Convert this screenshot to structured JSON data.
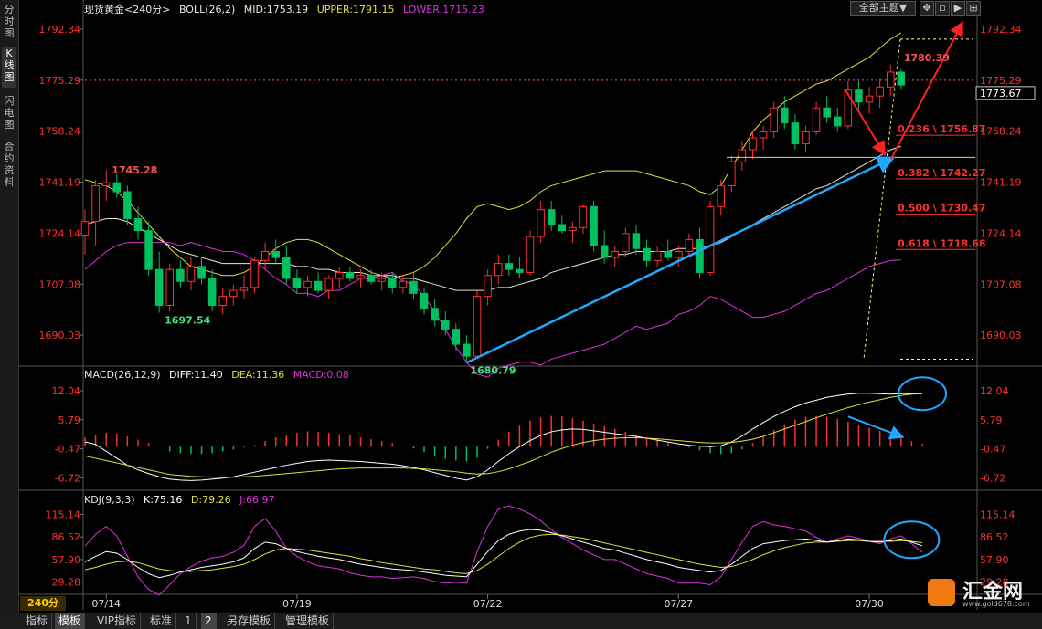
{
  "left_tabs": [
    "分时图",
    "K线图",
    "闪电图",
    "合约资料"
  ],
  "top_buttons": {
    "theme": "全部主题▼",
    "btn1": "✥",
    "btn2": "▫",
    "btn3": "▶",
    "btn4": "⊞"
  },
  "price_panel": {
    "symbol": "现货黄金<240分>",
    "boll_label": "BOLL(26,2)",
    "mid_label": "MID:1753.19",
    "upper_label": "UPPER:1791.15",
    "lower_label": "LOWER:1715.23",
    "y_ticks": [
      1792.34,
      1775.29,
      1758.24,
      1741.19,
      1724.14,
      1707.08,
      1690.03
    ],
    "current_price": "1773.67",
    "annotations": {
      "high": "1780.39",
      "left_high": "1745.28",
      "left_low": "1697.54",
      "low": "1680.79"
    },
    "fib_levels": [
      {
        "label": "0.236 \\ 1756.87",
        "value": 1756.87
      },
      {
        "label": "0.382 \\ 1742.27",
        "value": 1742.27
      },
      {
        "label": "0.500 \\ 1730.47",
        "value": 1730.47
      },
      {
        "label": "0.618 \\ 1718.68",
        "value": 1718.68
      }
    ]
  },
  "macd_panel": {
    "label": "MACD(26,12,9)",
    "diff_label": "DIFF:11.40",
    "dea_label": "DEA:11.36",
    "macd_label": "MACD:0.08",
    "y_ticks": [
      12.04,
      5.79,
      -0.47,
      -6.72
    ]
  },
  "kdj_panel": {
    "label": "KDJ(9,3,3)",
    "k_label": "K:75.16",
    "d_label": "D:79.26",
    "j_label": "J:66.97",
    "y_ticks": [
      115.14,
      86.52,
      57.9,
      29.28
    ]
  },
  "x_dates": [
    "07/14",
    "07/19",
    "07/22",
    "07/27",
    "07/30"
  ],
  "period": "240分",
  "bottom_tabs": [
    "指标",
    "模板",
    "VIP指标",
    "标准",
    "1",
    "2",
    "另存模板",
    "管理模板"
  ],
  "watermark": {
    "name": "汇金网",
    "url": "www.gold678.com"
  },
  "colors": {
    "up": "#ff3030",
    "down": "#00c060",
    "mid": "#e8e8d0",
    "upper": "#e0e040",
    "lower": "#e030e0",
    "dif": "#ffffff",
    "dea": "#e0e040",
    "k": "#ffffff",
    "d": "#e0e040",
    "j": "#e030e0",
    "trend": "#1ea8ff",
    "arrow_red": "#ff2020",
    "axis": "#ff3030"
  },
  "chart_data": {
    "type": "candlestick",
    "xlim": [
      0,
      84
    ],
    "price_ylim": [
      1680.0,
      1796.0
    ],
    "date_index": [
      [
        2,
        "07/14"
      ],
      [
        20,
        "07/19"
      ],
      [
        38,
        "07/22"
      ],
      [
        56,
        "07/27"
      ],
      [
        74,
        "07/30"
      ]
    ],
    "candles": [
      [
        1723.5,
        1732,
        1717,
        1728
      ],
      [
        1728,
        1742,
        1720,
        1740
      ],
      [
        1740,
        1745.28,
        1735,
        1741
      ],
      [
        1741,
        1744,
        1736,
        1738
      ],
      [
        1738,
        1740,
        1727,
        1729
      ],
      [
        1729,
        1733,
        1722,
        1725
      ],
      [
        1725,
        1728,
        1710,
        1712
      ],
      [
        1712,
        1718,
        1697.54,
        1700
      ],
      [
        1700,
        1714,
        1698,
        1712
      ],
      [
        1712,
        1715,
        1706,
        1708
      ],
      [
        1708,
        1716,
        1705,
        1713
      ],
      [
        1713,
        1716,
        1707,
        1709
      ],
      [
        1709,
        1712,
        1698,
        1700
      ],
      [
        1700,
        1706,
        1697,
        1703
      ],
      [
        1703,
        1707,
        1700,
        1705
      ],
      [
        1705,
        1710,
        1702,
        1706
      ],
      [
        1706,
        1716,
        1704,
        1715
      ],
      [
        1715,
        1721,
        1712,
        1718
      ],
      [
        1718,
        1722,
        1714,
        1716
      ],
      [
        1716,
        1720,
        1707,
        1709
      ],
      [
        1709,
        1712,
        1704,
        1706
      ],
      [
        1706,
        1710,
        1703,
        1708
      ],
      [
        1708,
        1711,
        1704,
        1705
      ],
      [
        1705,
        1710,
        1702,
        1709
      ],
      [
        1709,
        1713,
        1706,
        1711
      ],
      [
        1711,
        1713,
        1708,
        1709
      ],
      [
        1709,
        1712,
        1706,
        1710
      ],
      [
        1710,
        1712,
        1707,
        1708
      ],
      [
        1708,
        1711,
        1705,
        1709
      ],
      [
        1709,
        1711,
        1704,
        1706
      ],
      [
        1706,
        1710,
        1704,
        1708
      ],
      [
        1708,
        1711,
        1702,
        1704
      ],
      [
        1704,
        1706,
        1697,
        1699
      ],
      [
        1699,
        1702,
        1693,
        1695
      ],
      [
        1695,
        1698,
        1690,
        1692
      ],
      [
        1692,
        1694,
        1685,
        1687
      ],
      [
        1687,
        1690,
        1680.79,
        1683
      ],
      [
        1683,
        1705,
        1682,
        1703
      ],
      [
        1703,
        1712,
        1700,
        1710
      ],
      [
        1710,
        1717,
        1707,
        1714
      ],
      [
        1714,
        1717,
        1710,
        1712
      ],
      [
        1712,
        1716,
        1709,
        1711
      ],
      [
        1711,
        1725,
        1710,
        1723
      ],
      [
        1723,
        1735,
        1721,
        1732
      ],
      [
        1732,
        1735,
        1725,
        1727
      ],
      [
        1727,
        1730,
        1724,
        1725
      ],
      [
        1725,
        1728,
        1721,
        1726
      ],
      [
        1726,
        1734,
        1724,
        1733
      ],
      [
        1733,
        1735,
        1718,
        1720
      ],
      [
        1720,
        1725,
        1714,
        1716
      ],
      [
        1716,
        1720,
        1713,
        1718
      ],
      [
        1718,
        1726,
        1716,
        1724
      ],
      [
        1724,
        1727,
        1717,
        1719
      ],
      [
        1719,
        1722,
        1713,
        1715
      ],
      [
        1715,
        1720,
        1713,
        1718
      ],
      [
        1718,
        1722,
        1715,
        1716
      ],
      [
        1716,
        1720,
        1713,
        1718
      ],
      [
        1718,
        1724,
        1716,
        1722
      ],
      [
        1722,
        1726,
        1709,
        1711
      ],
      [
        1711,
        1735,
        1710,
        1733
      ],
      [
        1733,
        1742,
        1730,
        1740
      ],
      [
        1740,
        1750,
        1738,
        1748
      ],
      [
        1748,
        1755,
        1745,
        1752
      ],
      [
        1752,
        1758,
        1749,
        1756
      ],
      [
        1756,
        1760,
        1752,
        1758
      ],
      [
        1758,
        1768,
        1756,
        1766
      ],
      [
        1766,
        1770,
        1759,
        1761
      ],
      [
        1761,
        1764,
        1752,
        1754
      ],
      [
        1754,
        1760,
        1751,
        1758
      ],
      [
        1758,
        1768,
        1757,
        1766
      ],
      [
        1766,
        1770,
        1761,
        1763
      ],
      [
        1763,
        1766,
        1758,
        1760
      ],
      [
        1760,
        1775,
        1759,
        1772
      ],
      [
        1772,
        1775,
        1765,
        1768
      ],
      [
        1768,
        1773,
        1764,
        1770
      ],
      [
        1770,
        1776,
        1766,
        1773
      ],
      [
        1773,
        1780.39,
        1770,
        1778
      ],
      [
        1778,
        1779,
        1772,
        1773.67
      ]
    ],
    "boll_upper": [
      1742,
      1741,
      1740,
      1738,
      1735,
      1731,
      1727,
      1723,
      1719,
      1716,
      1713,
      1712,
      1711,
      1710,
      1710,
      1711,
      1713,
      1716,
      1719,
      1721,
      1722,
      1722,
      1721,
      1719,
      1717,
      1715,
      1713,
      1711,
      1710,
      1709,
      1710,
      1711,
      1713,
      1716,
      1720,
      1724,
      1729,
      1733,
      1734,
      1733,
      1732,
      1733,
      1735,
      1738,
      1740,
      1741,
      1742,
      1743,
      1744,
      1745,
      1745,
      1745,
      1745,
      1744,
      1743,
      1742,
      1741,
      1740,
      1738,
      1737,
      1740,
      1746,
      1752,
      1758,
      1762,
      1765,
      1768,
      1770,
      1772,
      1774,
      1775,
      1777,
      1779,
      1781,
      1783,
      1786,
      1789,
      1791.15
    ],
    "boll_mid": [
      1727,
      1728,
      1729,
      1729,
      1728,
      1726,
      1724,
      1722,
      1720,
      1718,
      1717,
      1716,
      1715,
      1714,
      1714,
      1714,
      1714,
      1714,
      1714,
      1714,
      1713,
      1713,
      1712,
      1712,
      1711,
      1711,
      1711,
      1710,
      1710,
      1710,
      1709,
      1709,
      1708,
      1707,
      1706,
      1705,
      1705,
      1705,
      1705,
      1706,
      1706,
      1707,
      1708,
      1709,
      1711,
      1712,
      1713,
      1714,
      1715,
      1716,
      1717,
      1717,
      1718,
      1718,
      1718,
      1718,
      1719,
      1719,
      1719,
      1720,
      1721,
      1723,
      1725,
      1727,
      1729,
      1731,
      1733,
      1735,
      1737,
      1739,
      1740,
      1742,
      1744,
      1746,
      1748,
      1750,
      1752,
      1753.19
    ],
    "boll_lower": [
      1712,
      1715,
      1718,
      1720,
      1721,
      1721,
      1721,
      1721,
      1721,
      1720,
      1721,
      1720,
      1719,
      1718,
      1718,
      1717,
      1715,
      1712,
      1709,
      1707,
      1704,
      1704,
      1703,
      1705,
      1705,
      1707,
      1709,
      1709,
      1710,
      1711,
      1708,
      1707,
      1703,
      1698,
      1692,
      1686,
      1681,
      1677,
      1676,
      1679,
      1680,
      1681,
      1681,
      1680,
      1682,
      1683,
      1684,
      1685,
      1686,
      1687,
      1689,
      1691,
      1693,
      1692,
      1693,
      1694,
      1697,
      1698,
      1700,
      1703,
      1702,
      1700,
      1698,
      1696,
      1696,
      1697,
      1698,
      1700,
      1702,
      1704,
      1705,
      1707,
      1709,
      1711,
      1713,
      1714,
      1715,
      1715.23
    ],
    "macd_ylim": [
      -9.0,
      14.0
    ],
    "macd_hist": [
      2,
      2.5,
      3,
      2.8,
      2.2,
      1.5,
      0.8,
      0,
      -1,
      -1.4,
      -1.5,
      -1.6,
      -1.4,
      -1,
      -0.6,
      -0.2,
      0.4,
      1.2,
      2,
      2.6,
      3,
      3.3,
      3.2,
      3,
      2.7,
      2.4,
      2,
      1.6,
      1.2,
      0.8,
      0.2,
      -0.4,
      -1.2,
      -2,
      -2.6,
      -3,
      -3.2,
      -2.4,
      -0.5,
      1.5,
      3.2,
      4.5,
      5.6,
      6.3,
      6.6,
      6.5,
      6.1,
      5.6,
      5,
      4.4,
      3.8,
      3.2,
      2.6,
      2,
      1.4,
      0.8,
      0.3,
      -0.2,
      -0.8,
      -1.4,
      -1.6,
      -1.4,
      -0.6,
      0.8,
      2.2,
      3.6,
      4.8,
      5.8,
      6.4,
      6.6,
      6.4,
      6,
      5.4,
      4.8,
      4.1,
      3.4,
      2.6,
      1.8,
      1.2,
      0.6,
      0.08
    ],
    "macd_dif": [
      1,
      0.5,
      -1,
      -2.5,
      -4,
      -5,
      -5.8,
      -6.5,
      -7,
      -7.2,
      -7.3,
      -7.2,
      -7,
      -6.8,
      -6.5,
      -6,
      -5.5,
      -5,
      -4.5,
      -4,
      -3.6,
      -3.2,
      -3,
      -2.9,
      -3,
      -3.1,
      -3.2,
      -3.4,
      -3.6,
      -3.8,
      -4.1,
      -4.5,
      -5,
      -5.6,
      -6.2,
      -6.8,
      -7.2,
      -6.5,
      -5,
      -3.2,
      -1.5,
      0,
      1.3,
      2.4,
      3.2,
      3.6,
      3.8,
      3.7,
      3.4,
      3.1,
      2.8,
      2.5,
      2.2,
      1.8,
      1.4,
      1,
      0.6,
      0.3,
      0.1,
      0,
      0.2,
      1,
      2.3,
      3.8,
      5.2,
      6.5,
      7.6,
      8.6,
      9.4,
      10,
      10.6,
      11,
      11.3,
      11.5,
      11.5,
      11.4,
      11.3,
      11.4,
      11.4,
      11.4
    ],
    "macd_dea": [
      -2,
      -2.5,
      -3,
      -3.5,
      -4,
      -4.5,
      -5,
      -5.5,
      -6,
      -6.2,
      -6.4,
      -6.5,
      -6.6,
      -6.6,
      -6.6,
      -6.5,
      -6.4,
      -6.2,
      -6,
      -5.8,
      -5.6,
      -5.4,
      -5.2,
      -5,
      -4.8,
      -4.7,
      -4.6,
      -4.6,
      -4.6,
      -4.6,
      -4.6,
      -4.7,
      -4.8,
      -5,
      -5.2,
      -5.4,
      -5.7,
      -5.9,
      -5.8,
      -5.4,
      -4.8,
      -4,
      -3.2,
      -2.2,
      -1.2,
      -0.4,
      0.3,
      0.9,
      1.3,
      1.6,
      1.8,
      1.9,
      1.9,
      1.8,
      1.7,
      1.5,
      1.3,
      1.1,
      0.9,
      0.8,
      0.8,
      0.9,
      1.2,
      1.6,
      2.2,
      3,
      3.8,
      4.6,
      5.4,
      6.2,
      7,
      7.7,
      8.4,
      9,
      9.6,
      10.1,
      10.6,
      11,
      11.3,
      11.36
    ],
    "kdj_ylim": [
      15.0,
      125.0
    ],
    "kdj_k": [
      55,
      62,
      68,
      66,
      58,
      48,
      40,
      35,
      38,
      42,
      45,
      48,
      50,
      52,
      55,
      60,
      72,
      80,
      78,
      72,
      68,
      65,
      62,
      60,
      58,
      55,
      52,
      50,
      48,
      46,
      45,
      44,
      42,
      40,
      38,
      37,
      36,
      52,
      68,
      82,
      90,
      94,
      96,
      95,
      92,
      88,
      84,
      80,
      76,
      72,
      70,
      66,
      62,
      58,
      55,
      52,
      48,
      46,
      44,
      42,
      44,
      52,
      62,
      72,
      78,
      80,
      82,
      83,
      84,
      82,
      80,
      82,
      84,
      83,
      81,
      80,
      82,
      84,
      80,
      75.16
    ],
    "kdj_d": [
      45,
      48,
      52,
      55,
      56,
      54,
      50,
      46,
      44,
      43,
      43,
      44,
      45,
      47,
      49,
      52,
      58,
      65,
      70,
      72,
      71,
      70,
      68,
      66,
      64,
      62,
      59,
      57,
      54,
      52,
      50,
      48,
      46,
      45,
      43,
      41,
      40,
      44,
      52,
      62,
      72,
      80,
      86,
      89,
      90,
      89,
      87,
      85,
      82,
      79,
      76,
      73,
      70,
      67,
      64,
      61,
      58,
      55,
      52,
      50,
      48,
      49,
      53,
      58,
      64,
      69,
      73,
      76,
      79,
      80,
      80,
      81,
      82,
      82,
      81,
      81,
      81,
      82,
      81,
      79.26
    ],
    "kdj_j": [
      75,
      90,
      100,
      88,
      62,
      36,
      20,
      13,
      26,
      40,
      49,
      56,
      60,
      62,
      67,
      76,
      100,
      110,
      94,
      72,
      62,
      55,
      50,
      48,
      46,
      41,
      38,
      36,
      36,
      34,
      35,
      36,
      34,
      30,
      28,
      29,
      28,
      68,
      100,
      122,
      126,
      122,
      116,
      107,
      96,
      86,
      78,
      70,
      64,
      58,
      58,
      52,
      46,
      40,
      37,
      34,
      28,
      28,
      28,
      26,
      36,
      58,
      80,
      100,
      106,
      102,
      100,
      97,
      94,
      86,
      80,
      84,
      88,
      85,
      81,
      78,
      84,
      88,
      78,
      66.97
    ]
  }
}
